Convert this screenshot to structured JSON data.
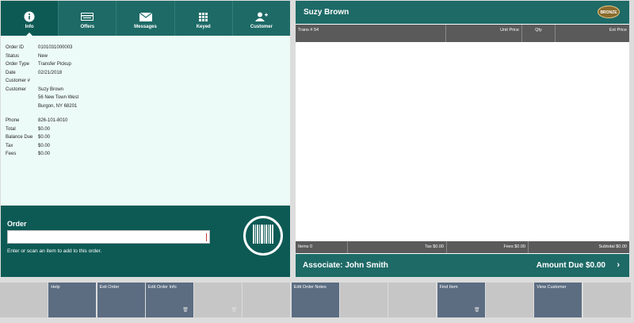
{
  "tabs": [
    {
      "label": "Info",
      "icon": "info-icon"
    },
    {
      "label": "Offers",
      "icon": "offers-icon"
    },
    {
      "label": "Messages",
      "icon": "envelope-icon"
    },
    {
      "label": "Keyed",
      "icon": "keypad-icon"
    },
    {
      "label": "Customer",
      "icon": "add-customer-icon"
    }
  ],
  "details": {
    "order_id": {
      "label": "Order ID",
      "value": "0101031000003"
    },
    "status": {
      "label": "Status",
      "value": "New"
    },
    "order_type": {
      "label": "Order Type",
      "value": "Transfer Pickup"
    },
    "date": {
      "label": "Date",
      "value": "02/21/2018"
    },
    "customer_no": {
      "label": "Customer #",
      "value": ""
    },
    "customer": {
      "label": "Customer",
      "line1": "Suzy Brown",
      "line2": "56 New Town West",
      "line3": "Burgon, NY 68201"
    },
    "phone": {
      "label": "Phone",
      "value": "826-101-8010"
    },
    "total": {
      "label": "Total",
      "value": "$0.00"
    },
    "balance_due": {
      "label": "Balance Due",
      "value": "$0.00"
    },
    "tax": {
      "label": "Tax",
      "value": "$0.00"
    },
    "fees": {
      "label": "Fees",
      "value": "$0.00"
    }
  },
  "order": {
    "title": "Order",
    "input_value": "",
    "hint": "Enter or scan an item to add to this order."
  },
  "customer_panel": {
    "name": "Suzy Brown",
    "badge": "BRONZE",
    "columns": {
      "trans": "Trans # 54",
      "unit_price": "Unit Price",
      "qty": "Qty",
      "ext_price": "Ext Price"
    },
    "footer": {
      "items": "Items 0",
      "tax": "Tax $0.00",
      "fees": "Fees $0.00",
      "subtotal": "Subtotal $0.00"
    },
    "associate": "Associate: John Smith",
    "amount_due": "Amount Due  $0.00"
  },
  "function_keys": [
    {
      "label": "",
      "enabled": false
    },
    {
      "label": "Help",
      "enabled": true
    },
    {
      "label": "Exit Order",
      "enabled": true
    },
    {
      "label": "Edit Order Info",
      "enabled": true,
      "trash": true
    },
    {
      "label": "",
      "enabled": false,
      "trash": true
    },
    {
      "label": "",
      "enabled": false
    },
    {
      "label": "Edit Order Notes",
      "enabled": true
    },
    {
      "label": "",
      "enabled": false
    },
    {
      "label": "",
      "enabled": false
    },
    {
      "label": "Find Item",
      "enabled": true,
      "trash": true
    },
    {
      "label": "",
      "enabled": false
    },
    {
      "label": "View Customer",
      "enabled": true
    },
    {
      "label": "",
      "enabled": false
    }
  ],
  "colors": {
    "teal": "#1d6a66",
    "dark_teal": "#0d5a55",
    "fkey": "#5c6d82"
  }
}
